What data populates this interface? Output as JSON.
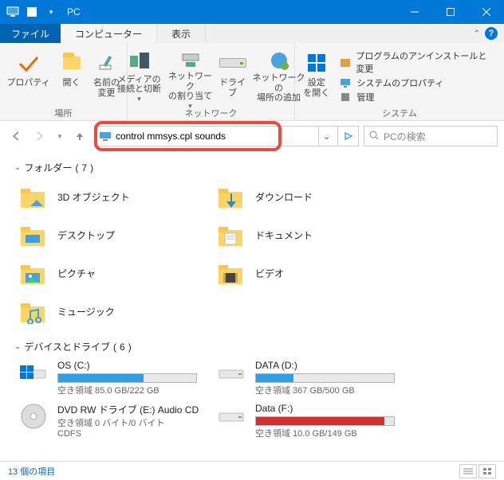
{
  "window": {
    "title": "PC"
  },
  "tabs": {
    "file": "ファイル",
    "computer": "コンピューター",
    "view": "表示"
  },
  "ribbon": {
    "group_place": "場所",
    "group_network": "ネットワーク",
    "group_system": "システム",
    "btn_properties": "プロパティ",
    "btn_open": "開く",
    "btn_rename": "名前の\n変更",
    "btn_media": "メディアの\n接続と切断",
    "btn_network_drive": "ネットワーク\nの割り当て",
    "btn_map_drive": "ドライブ",
    "btn_add_netloc": "ネットワークの\n場所の追加",
    "btn_settings": "設定\nを開く",
    "row_uninstall": "プログラムのアンインストールと変更",
    "row_sysprops": "システムのプロパティ",
    "row_manage": "管理"
  },
  "address": {
    "value": "control mmsys.cpl sounds"
  },
  "search": {
    "placeholder": "PCの検索"
  },
  "groups": {
    "folders": {
      "label": "フォルダー",
      "count": 7
    },
    "devices": {
      "label": "デバイスとドライブ",
      "count": 6
    }
  },
  "folders": [
    {
      "name": "3D オブジェクト"
    },
    {
      "name": "ダウンロード"
    },
    {
      "name": "デスクトップ"
    },
    {
      "name": "ドキュメント"
    },
    {
      "name": "ピクチャ"
    },
    {
      "name": "ビデオ"
    },
    {
      "name": "ミュージック"
    }
  ],
  "drives": [
    {
      "name": "OS (C:)",
      "sub": "空き領域 85.0 GB/222 GB",
      "fill": 0.62,
      "color": "#2e9fe6",
      "bar": true
    },
    {
      "name": "DATA (D:)",
      "sub": "空き領域 367 GB/500 GB",
      "fill": 0.27,
      "color": "#2e9fe6",
      "bar": true
    },
    {
      "name": "DVD RW ドライブ (E:) Audio CD",
      "sub": "空き領域 0 バイト/0 バイト",
      "sub2": "CDFS",
      "bar": false
    },
    {
      "name": "Data (F:)",
      "sub": "空き領域 10.0 GB/149 GB",
      "fill": 0.93,
      "color": "#d43030",
      "bar": true
    }
  ],
  "status": {
    "text": "13 個の項目"
  }
}
